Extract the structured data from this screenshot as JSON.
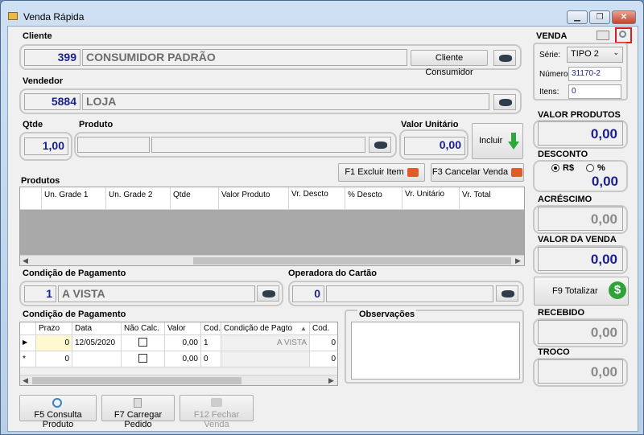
{
  "window": {
    "title": "Venda Rápida",
    "minimize": "▁",
    "restore": "❐",
    "close": "✕"
  },
  "cliente": {
    "label": "Cliente",
    "code": "399",
    "name": "CONSUMIDOR PADRÃO",
    "button": "Cliente Consumidor"
  },
  "vendedor": {
    "label": "Vendedor",
    "code": "5884",
    "name": "LOJA"
  },
  "produto": {
    "qtde_label": "Qtde",
    "qtde_value": "1,00",
    "produto_label": "Produto",
    "code": "",
    "description": "",
    "valor_unitario_label": "Valor Unitário",
    "valor_unitario": "0,00",
    "incluir_button": "Incluir"
  },
  "produtos": {
    "label": "Produtos",
    "excluir_button": "F1 Excluir Item",
    "cancelar_button": "F3 Cancelar Venda",
    "columns": [
      "Un. Grade 1",
      "Un. Grade 2",
      "Qtde",
      "Valor Produto",
      "Vr. Descto",
      "% Descto",
      "Vr. Unitário",
      "Vr. Total"
    ]
  },
  "pagamento": {
    "label": "Condição de Pagamento",
    "code": "1",
    "name": "A VISTA"
  },
  "operadora": {
    "label": "Operadora do Cartão",
    "code": "0",
    "name": ""
  },
  "condicao_grid": {
    "label": "Condição de Pagamento",
    "columns": [
      "Prazo",
      "Data",
      "Não Calc.",
      "Valor",
      "Cod.",
      "Condição de Pagto",
      "Cod."
    ],
    "rows": [
      {
        "marker": "▶",
        "prazo": "0",
        "data": "12/05/2020",
        "valor": "0,00",
        "cod": "1",
        "condicao": "A VISTA",
        "cod2": "0"
      },
      {
        "marker": "*",
        "prazo": "0",
        "data": "",
        "valor": "0,00",
        "cod": "0",
        "condicao": "",
        "cod2": "0"
      }
    ]
  },
  "observacoes": {
    "label": "Observações",
    "value": ""
  },
  "bottom_buttons": {
    "consulta": "F5 Consulta Produto",
    "carregar": "F7 Carregar Pedido",
    "fechar": "F12 Fechar Venda"
  },
  "venda": {
    "label": "VENDA",
    "serie_label": "Série:",
    "serie_value": "TIPO 2",
    "numero_label": "Número:",
    "numero_value": "31170-2",
    "itens_label": "Itens:",
    "itens_value": "0"
  },
  "totais": {
    "valor_produtos_label": "VALOR PRODUTOS",
    "valor_produtos": "0,00",
    "desconto_label": "DESCONTO",
    "desconto_rs": "R$",
    "desconto_pct": "%",
    "desconto": "0,00",
    "acrescimo_label": "ACRÉSCIMO",
    "acrescimo": "0,00",
    "valor_venda_label": "VALOR DA VENDA",
    "valor_venda": "0,00",
    "totalizar_button": "F9 Totalizar",
    "recebido_label": "RECEBIDO",
    "recebido": "0,00",
    "troco_label": "TROCO",
    "troco": "0,00"
  }
}
